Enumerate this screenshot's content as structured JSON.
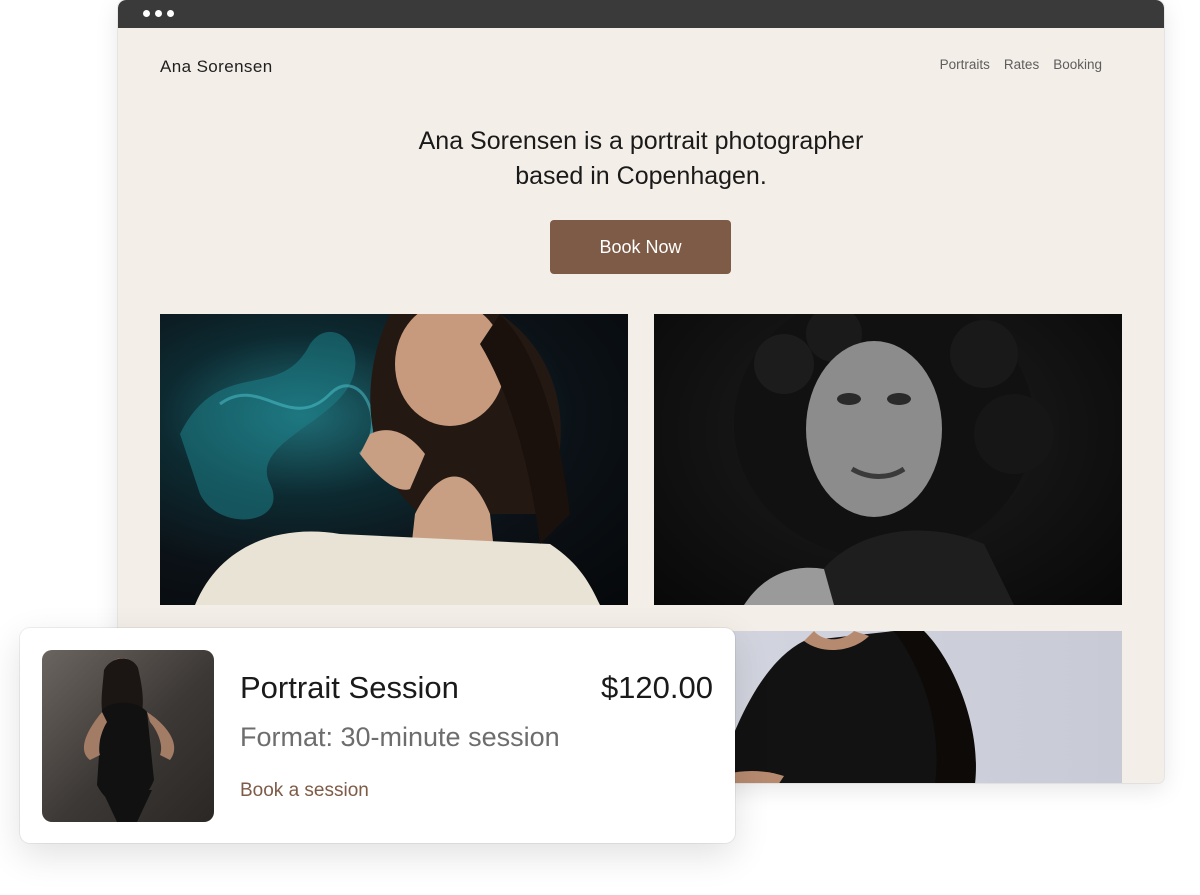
{
  "site": {
    "brand": "Ana Sorensen",
    "nav": [
      "Portraits",
      "Rates",
      "Booking"
    ],
    "headline_line1": "Ana Sorensen is a portrait photographer",
    "headline_line2": "based in Copenhagen.",
    "cta_label": "Book Now",
    "accent_color": "#7e5b46",
    "background_color": "#f4eee8"
  },
  "gallery": [
    {
      "name": "portrait-woman-smoke-photo",
      "icon": "photo"
    },
    {
      "name": "portrait-curly-hair-bw-photo",
      "icon": "photo"
    },
    {
      "name": "portrait-black-dress-photo",
      "icon": "photo"
    }
  ],
  "product_card": {
    "title": "Portrait Session",
    "price": "$120.00",
    "format": "Format: 30-minute session",
    "link": "Book a session"
  }
}
